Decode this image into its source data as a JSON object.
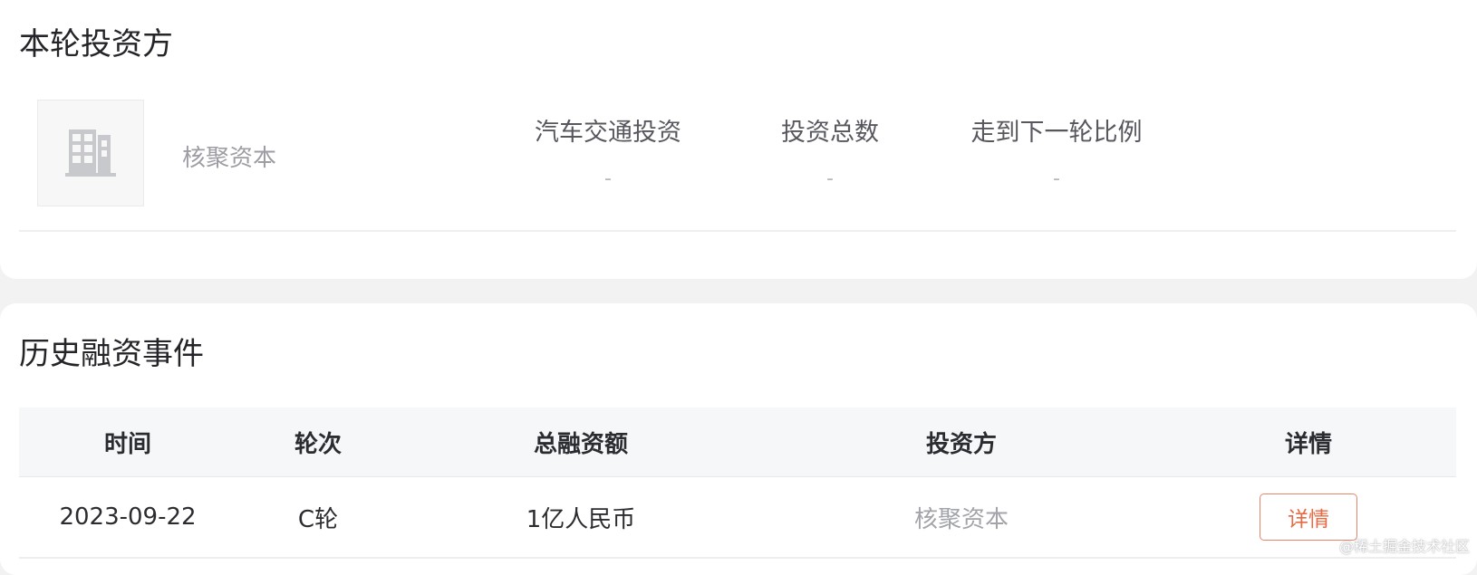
{
  "investors_section": {
    "title": "本轮投资方",
    "investor": {
      "logo_icon": "building-icon",
      "name": "核聚资本"
    },
    "stats": [
      {
        "label": "汽车交通投资",
        "value": "-"
      },
      {
        "label": "投资总数",
        "value": "-"
      },
      {
        "label": "走到下一轮比例",
        "value": "-"
      }
    ]
  },
  "history_section": {
    "title": "历史融资事件",
    "table": {
      "headers": [
        "时间",
        "轮次",
        "总融资额",
        "投资方",
        "详情"
      ],
      "rows": [
        {
          "date": "2023-09-22",
          "round": "C轮",
          "amount": "1亿人民币",
          "investor": "核聚资本",
          "detail_label": "详情"
        }
      ]
    }
  },
  "watermark": "@稀土掘金技术社区",
  "colors": {
    "accent": "#e66b45",
    "muted_text": "#9c9ea4",
    "header_bg": "#f6f7f9"
  }
}
